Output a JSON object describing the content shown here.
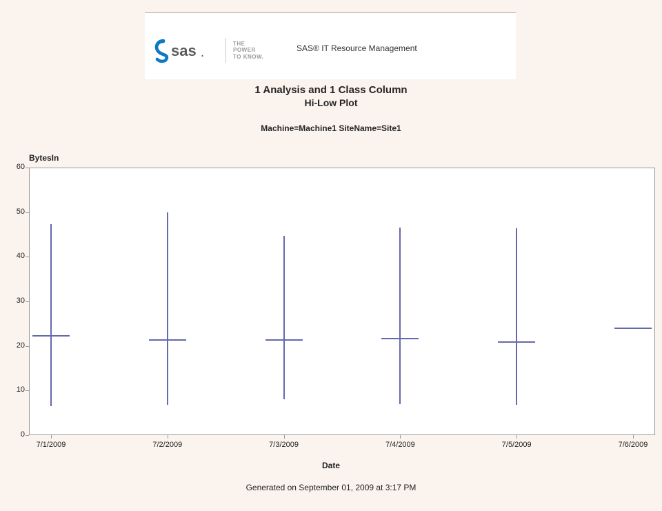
{
  "header": {
    "tagline": "THE\nPOWER\nTO KNOW.",
    "product": "SAS® IT Resource Management"
  },
  "titles": {
    "line1": "1 Analysis and 1 Class Column",
    "line2": "Hi-Low Plot",
    "line3": "Machine=Machine1 SiteName=Site1"
  },
  "axes": {
    "ylabel": "BytesIn",
    "xlabel": "Date",
    "yticks": [
      "0",
      "10",
      "20",
      "30",
      "40",
      "50",
      "60"
    ],
    "xticks": [
      "7/1/2009",
      "7/2/2009",
      "7/3/2009",
      "7/4/2009",
      "7/5/2009",
      "7/6/2009"
    ]
  },
  "footer": "Generated on September 01, 2009 at 3:17 PM",
  "chart_data": {
    "type": "hilo",
    "xlabel": "Date",
    "ylabel": "BytesIn",
    "ylim": [
      0,
      60
    ],
    "categories": [
      "7/1/2009",
      "7/2/2009",
      "7/3/2009",
      "7/4/2009",
      "7/5/2009",
      "7/6/2009"
    ],
    "series": [
      {
        "name": "low",
        "values": [
          6.5,
          6.8,
          8.0,
          7.0,
          6.8,
          23.8
        ]
      },
      {
        "name": "high",
        "values": [
          47.3,
          49.9,
          44.7,
          46.6,
          46.4,
          24.0
        ]
      },
      {
        "name": "mid",
        "values": [
          22.2,
          21.3,
          21.4,
          21.6,
          20.9,
          23.9
        ]
      }
    ]
  }
}
